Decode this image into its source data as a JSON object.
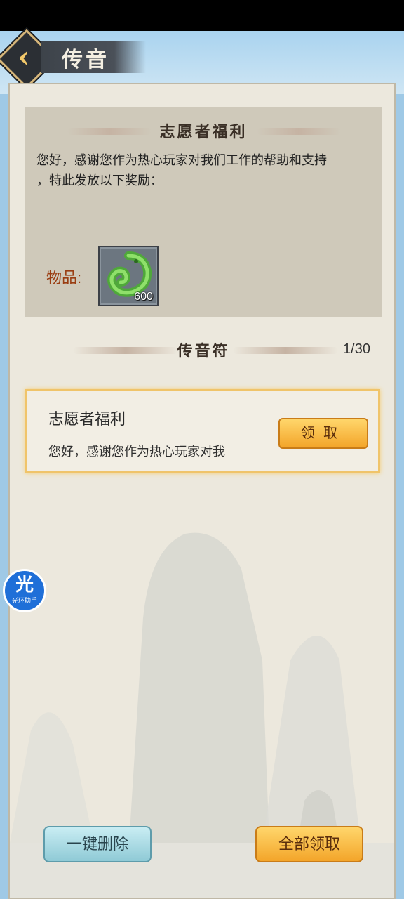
{
  "header": {
    "title": "传音"
  },
  "detail": {
    "title": "志愿者福利",
    "body_line1": "您好，感谢您作为热心玩家对我们工作的帮助和支持",
    "body_line2": "，特此发放以下奖励：",
    "items_label": "物品:",
    "item": {
      "icon": "jade-dragon-icon",
      "count": "600"
    }
  },
  "list": {
    "title": "传音符",
    "page_count": "1/30",
    "mails": [
      {
        "title": "志愿者福利",
        "preview": "您好，感谢您作为热心玩家对我",
        "claim_label": "领取"
      }
    ]
  },
  "float_badge": {
    "glyph": "光",
    "label": "光环助手"
  },
  "footer": {
    "delete_all_label": "一键删除",
    "claim_all_label": "全部领取"
  },
  "colors": {
    "accent": "#f3a52a",
    "panel": "#ece8dd",
    "detail_bg": "#cfc9ba",
    "items_label": "#9a3d12"
  }
}
